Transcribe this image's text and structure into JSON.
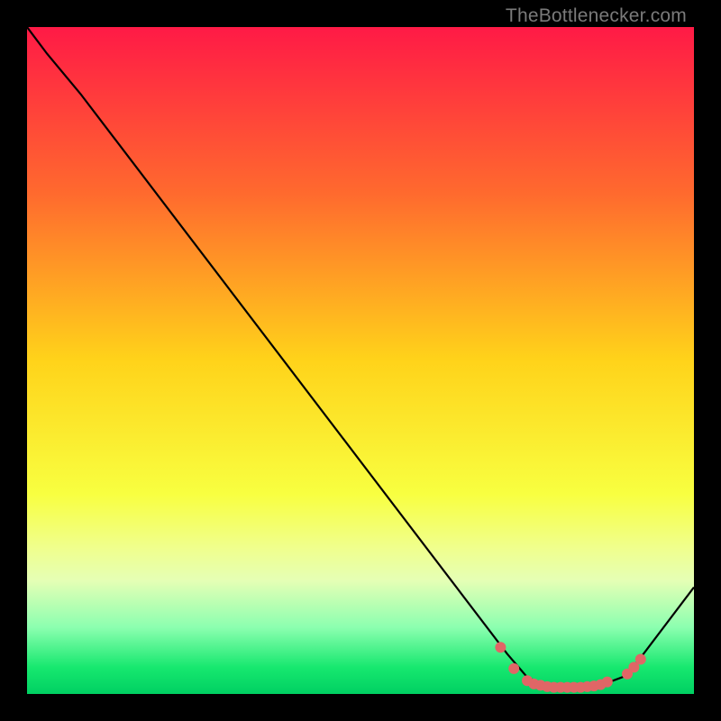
{
  "watermark": "TheBottlenecker.com",
  "chart_data": {
    "type": "line",
    "title": "",
    "xlabel": "",
    "ylabel": "",
    "xlim": [
      0,
      100
    ],
    "ylim": [
      0,
      100
    ],
    "gradient_stops": [
      {
        "offset": 0.0,
        "color": "#ff1a46"
      },
      {
        "offset": 0.25,
        "color": "#ff6a2e"
      },
      {
        "offset": 0.5,
        "color": "#ffd31a"
      },
      {
        "offset": 0.7,
        "color": "#f8ff40"
      },
      {
        "offset": 0.78,
        "color": "#f0ff8c"
      },
      {
        "offset": 0.83,
        "color": "#e5ffb5"
      },
      {
        "offset": 0.9,
        "color": "#8cffb0"
      },
      {
        "offset": 0.96,
        "color": "#17e86f"
      },
      {
        "offset": 1.0,
        "color": "#00d062"
      }
    ],
    "series": [
      {
        "name": "curve",
        "color": "#000000",
        "points": [
          {
            "x": 0,
            "y": 100
          },
          {
            "x": 3,
            "y": 96
          },
          {
            "x": 8,
            "y": 90
          },
          {
            "x": 72,
            "y": 6
          },
          {
            "x": 75,
            "y": 2.5
          },
          {
            "x": 78,
            "y": 1.2
          },
          {
            "x": 82,
            "y": 1.0
          },
          {
            "x": 86,
            "y": 1.3
          },
          {
            "x": 90,
            "y": 2.8
          },
          {
            "x": 100,
            "y": 16
          }
        ]
      }
    ],
    "markers": [
      {
        "x": 71,
        "y": 7.0
      },
      {
        "x": 73,
        "y": 3.8
      },
      {
        "x": 75,
        "y": 2.0
      },
      {
        "x": 76,
        "y": 1.5
      },
      {
        "x": 77,
        "y": 1.3
      },
      {
        "x": 78,
        "y": 1.1
      },
      {
        "x": 79,
        "y": 1.0
      },
      {
        "x": 80,
        "y": 1.0
      },
      {
        "x": 81,
        "y": 1.0
      },
      {
        "x": 82,
        "y": 1.0
      },
      {
        "x": 83,
        "y": 1.0
      },
      {
        "x": 84,
        "y": 1.1
      },
      {
        "x": 85,
        "y": 1.2
      },
      {
        "x": 86,
        "y": 1.4
      },
      {
        "x": 87,
        "y": 1.8
      },
      {
        "x": 90,
        "y": 3.0
      },
      {
        "x": 91,
        "y": 4.0
      },
      {
        "x": 92,
        "y": 5.2
      }
    ],
    "marker_color": "#e06666",
    "marker_radius": 6
  }
}
